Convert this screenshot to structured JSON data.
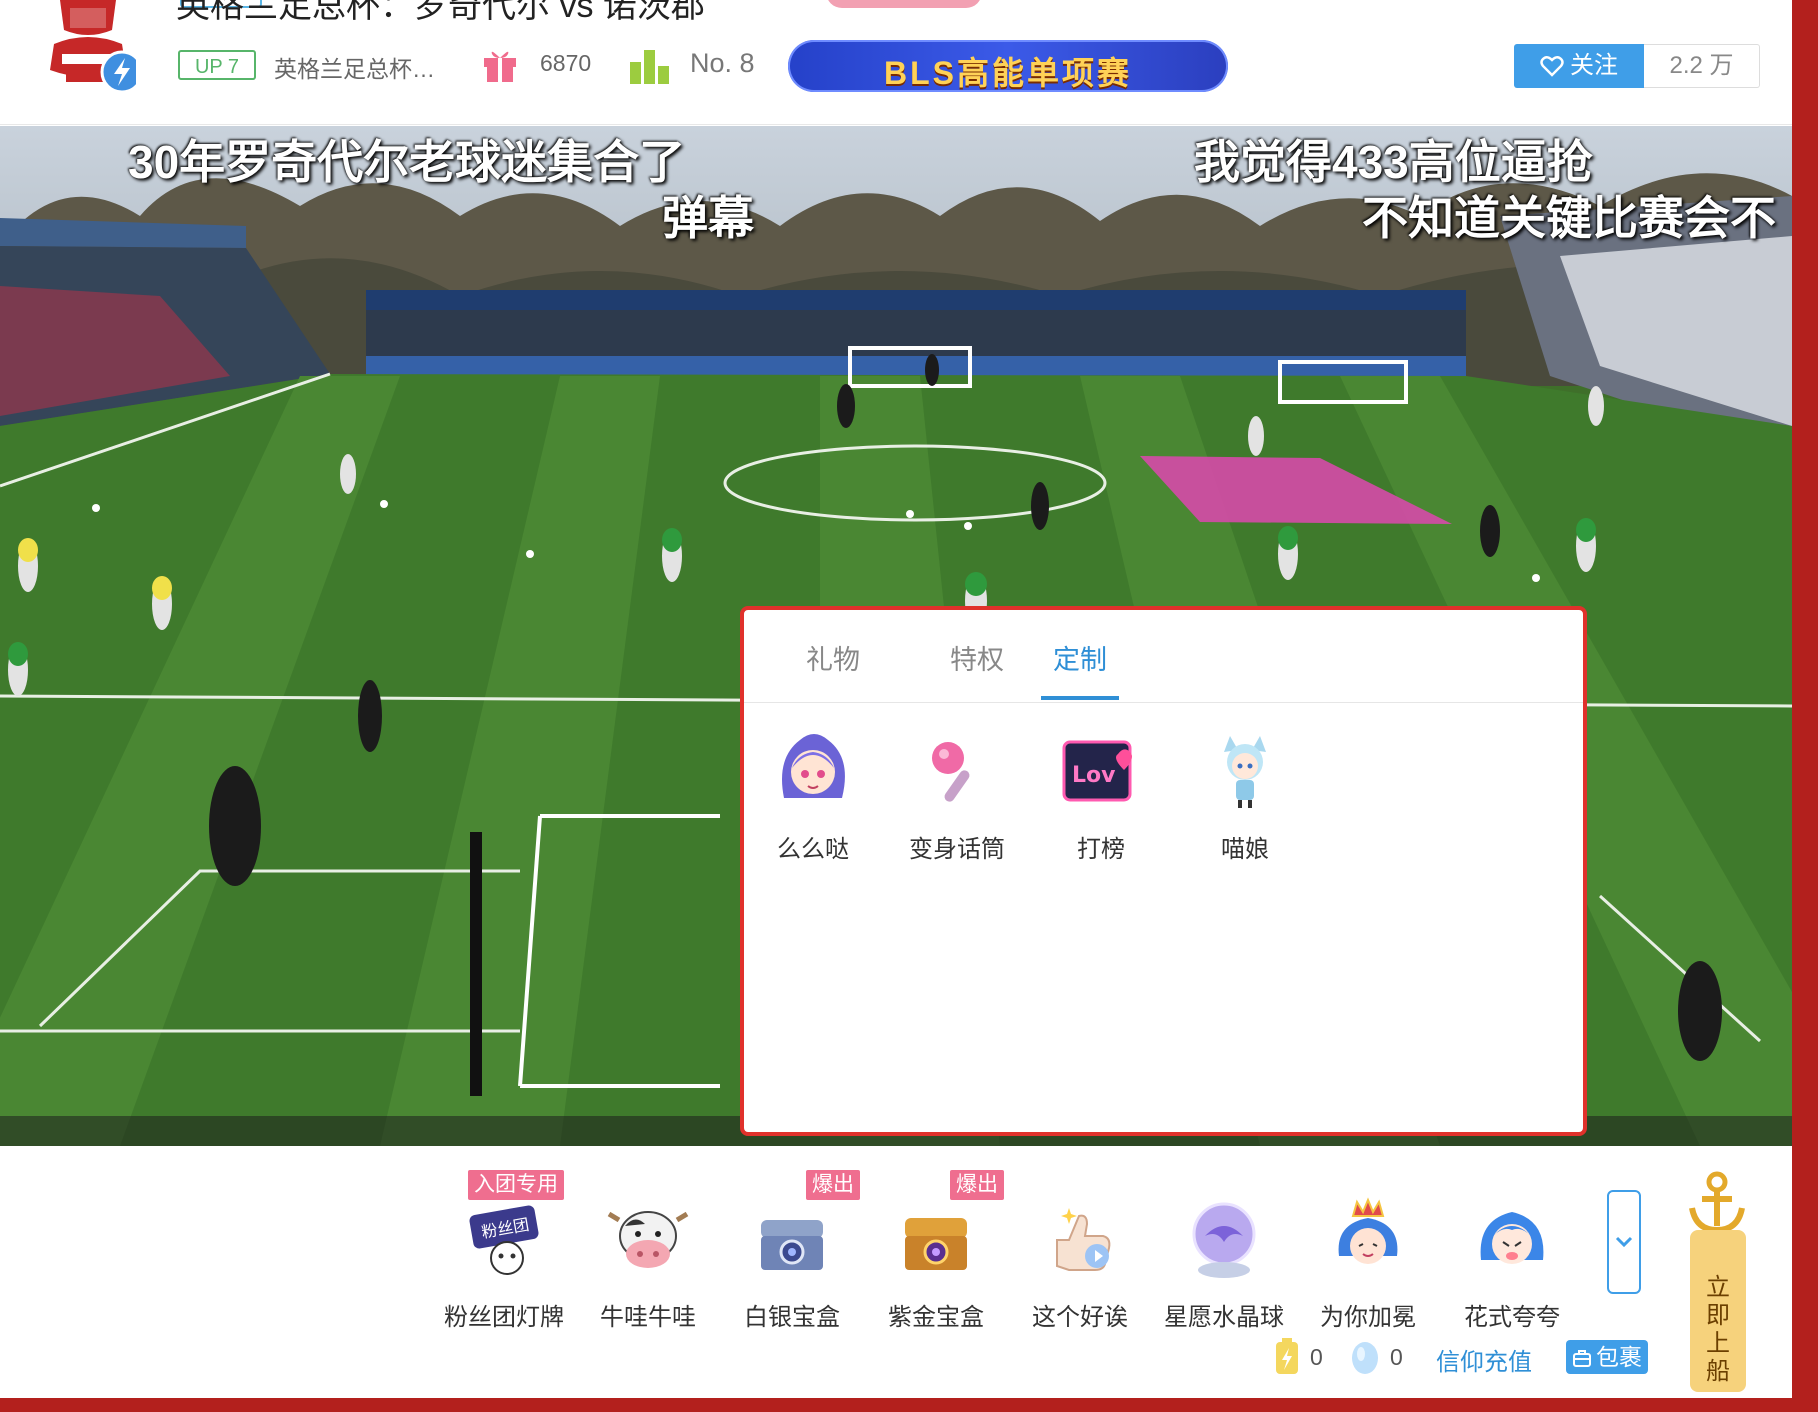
{
  "header": {
    "top_cut_title": "英格兰足总杯：罗奇代尔 vs 诺茨郡",
    "up_badge": "UP 7",
    "area_name": "英格兰足总杯…",
    "gift_count": "6870",
    "rank": "No. 8",
    "banner_text": "BLS高能单项赛",
    "follow_label": "关注",
    "follower_count": "2.2 万"
  },
  "danmaku": [
    {
      "text": "30年罗奇代尔老球迷集合了"
    },
    {
      "text": "弹幕"
    },
    {
      "text": "我觉得433高位逼抢"
    },
    {
      "text": "不知道关键比赛会不"
    }
  ],
  "popup": {
    "tabs": [
      {
        "label": "礼物"
      },
      {
        "label": "特权"
      },
      {
        "label": "定制"
      }
    ],
    "active_tab": "定制",
    "items": [
      {
        "label": "么么哒",
        "icon": "anime-girl-blue-hair-icon"
      },
      {
        "label": "变身话筒",
        "icon": "pink-microphone-icon"
      },
      {
        "label": "打榜",
        "icon": "neon-love-sign-icon"
      },
      {
        "label": "喵娘",
        "icon": "cat-girl-icon"
      }
    ]
  },
  "giftbar": {
    "items": [
      {
        "label": "粉丝团灯牌",
        "badge": "入团专用",
        "icon": "fan-club-lightboard-icon"
      },
      {
        "label": "牛哇牛哇",
        "badge": "",
        "icon": "cow-face-icon"
      },
      {
        "label": "白银宝盒",
        "badge": "爆出",
        "icon": "silver-treasure-box-icon"
      },
      {
        "label": "紫金宝盒",
        "badge": "爆出",
        "icon": "purple-gold-treasure-box-icon"
      },
      {
        "label": "这个好诶",
        "badge": "",
        "icon": "thumbs-up-hand-icon"
      },
      {
        "label": "星愿水晶球",
        "badge": "",
        "icon": "crystal-ball-icon"
      },
      {
        "label": "为你加冕",
        "badge": "",
        "icon": "crowned-girl-icon"
      },
      {
        "label": "花式夸夸",
        "badge": "",
        "icon": "blue-hair-girl-icon"
      }
    ],
    "battery_count": "0",
    "seed_count": "0",
    "recharge_label": "信仰充值",
    "bag_label": "包裹",
    "boat_text": [
      "立",
      "即",
      "上",
      "船"
    ]
  },
  "colors": {
    "accent_blue": "#2f8fd6",
    "follow_blue": "#3f9ee8",
    "highlight_red": "#e0312b",
    "badge_pink": "#ef6e8f",
    "frame_red": "#b3201d"
  }
}
